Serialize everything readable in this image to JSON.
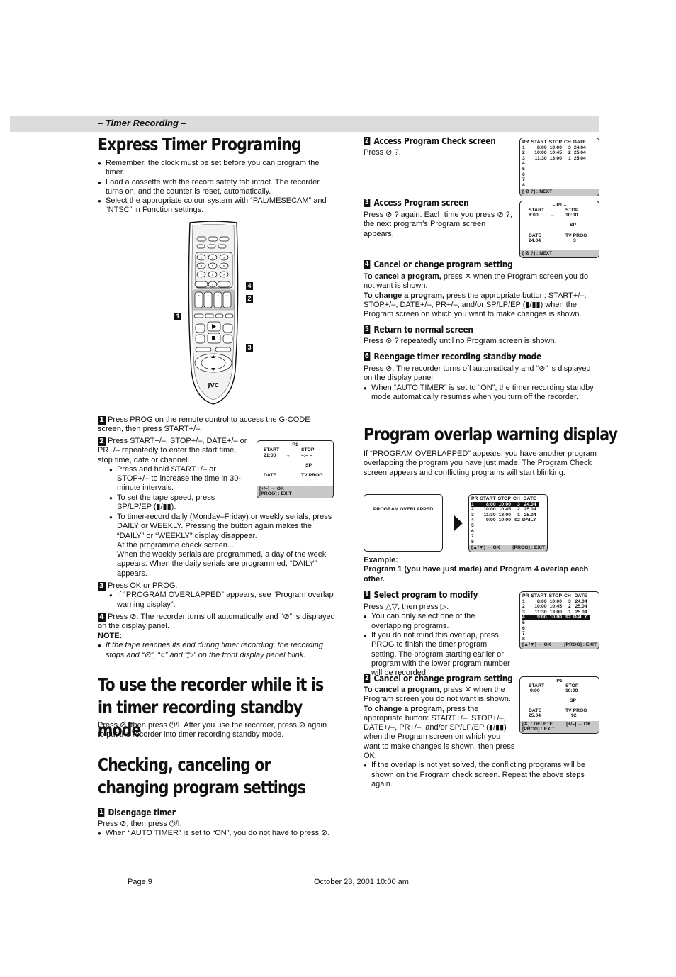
{
  "header": {
    "section": "– Timer Recording –"
  },
  "left": {
    "title": "Express Timer Programing",
    "intro_bullets": [
      "Remember, the clock must be set before you can program the timer.",
      "Load a cassette with the record safety tab intact. The recorder turns on, and the counter is reset, automatically.",
      "Select the appropriate colour system with “PAL/MESECAM” and “NTSC” in Function settings."
    ],
    "remote": {
      "brand": "JVC",
      "markers": [
        "1",
        "2",
        "3",
        "4"
      ],
      "numpad": [
        "1",
        "2",
        "3",
        "4",
        "5",
        "6",
        "7",
        "8",
        "9",
        "0"
      ]
    },
    "steps": [
      {
        "num": "1",
        "text": "Press PROG on the remote control to access the G-CODE screen, then press START+/–."
      },
      {
        "num": "2",
        "text": "Press START+/–, STOP+/–, DATE+/– or PR+/– repeatedly to enter the start time, stop time, date or channel.",
        "bullets": [
          "Press and hold START+/– or STOP+/– to increase the time in 30-minute intervals.",
          "To set the tape speed, press SP/LP/EP (▮/▮▮).",
          "To timer-record daily (Monday–Friday) or weekly serials, press DAILY or WEEKLY. Pressing the button again makes the “DAILY” or “WEEKLY” display disappear."
        ],
        "extra": [
          "At the programme check screen...",
          "When the weekly serials are programmed, a day of the week appears. When the daily serials are programmed, “DAILY” appears."
        ]
      },
      {
        "num": "3",
        "text": "Press OK or PROG.",
        "bullets": [
          "If “PROGRAM OVERLAPPED” appears, see “Program overlap warning display”."
        ]
      },
      {
        "num": "4",
        "text": "Press ⊘. The recorder turns off automatically and “⊘” is displayed on the display panel."
      }
    ],
    "note_label": "NOTE:",
    "note": "If the tape reaches its end during timer recording, the recording stops and “⊘”, “○” and “▷” on the front display panel blink.",
    "screen_p1_new": {
      "title": "– P1 –",
      "start_label": "START",
      "start": "21:00",
      "stop_label": "STOP",
      "stop": "–:– –",
      "speed": "SP",
      "date_label": "DATE",
      "date": "– –.– –",
      "tvprog_label": "TV PROG",
      "tvprog": "– –",
      "footer1": "[+/–] → OK",
      "footer2": "[PROG] : EXIT"
    },
    "standby_title": "To use the recorder while it is in timer recording standby mode",
    "standby_text": "Press ⊘, then press ⏻/I. After you use the recorder, press ⊘ again to put the recorder into timer recording standby mode.",
    "checking_title": "Checking, canceling or changing program settings",
    "disengage": {
      "num": "1",
      "title": "Disengage timer",
      "text": "Press ⊘, then press ⏻/I.",
      "bullet": "When “AUTO TIMER” is set to “ON”, you do not have to press ⊘."
    }
  },
  "right": {
    "steps": [
      {
        "num": "2",
        "title": "Access Program Check screen",
        "text": "Press ⊘ ?."
      },
      {
        "num": "3",
        "title": "Access Program screen",
        "text": "Press ⊘ ? again. Each time you press ⊘ ?, the next program’s Program screen appears."
      },
      {
        "num": "4",
        "title": "Cancel or change program setting",
        "cancel_label": "To cancel a program,",
        "cancel_text": " press ✕ when the Program screen you do not want is shown.",
        "change_label": "To change a program,",
        "change_text": " press the appropriate button: START+/–, STOP+/–, DATE+/–, PR+/–, and/or SP/LP/EP (▮/▮▮) when the Program screen on which you want to make changes is shown."
      },
      {
        "num": "5",
        "title": "Return to normal screen",
        "text": "Press ⊘ ? repeatedly until no Program screen is shown."
      },
      {
        "num": "6",
        "title": "Reengage timer recording standby mode",
        "text": "Press ⊘. The recorder turns off automatically and “⊘” is displayed on the display panel.",
        "bullet": "When “AUTO TIMER” is set to “ON”, the timer recording standby mode automatically resumes when you turn off the recorder."
      }
    ],
    "check_screen": {
      "headers": [
        "PR",
        "START",
        "STOP",
        "CH",
        "DATE"
      ],
      "rows": [
        [
          "1",
          "8:00",
          "10:00",
          "3",
          "24.04"
        ],
        [
          "2",
          "10:00",
          "10:45",
          "2",
          "25.04"
        ],
        [
          "3",
          "11:30",
          "13:00",
          "1",
          "25.04"
        ],
        [
          "4",
          "",
          "",
          "",
          ""
        ],
        [
          "5",
          "",
          "",
          "",
          ""
        ],
        [
          "6",
          "",
          "",
          "",
          ""
        ],
        [
          "7",
          "",
          "",
          "",
          ""
        ],
        [
          "8",
          "",
          "",
          "",
          ""
        ]
      ],
      "footer": "[ ⊘ ?] : NEXT"
    },
    "program_screen": {
      "title": "– P1 –",
      "start_label": "START",
      "start": "8:00",
      "stop_label": "STOP",
      "stop": "10:00",
      "speed": "SP",
      "date_label": "DATE",
      "date": "24.04",
      "tvprog_label": "TV PROG",
      "tvprog": "3",
      "footer": "[ ⊘ ?] : NEXT"
    },
    "overlap_title": "Program overlap warning display",
    "overlap_text": "If “PROGRAM OVERLAPPED” appears, you have another program overlapping the program you have just made. The Program Check screen appears and conflicting programs will start blinking.",
    "overlap_screen_text": "PROGRAM OVERLAPPED",
    "overlap_check": {
      "headers": [
        "PR",
        "START",
        "STOP",
        "CH",
        "DATE"
      ],
      "rows": [
        [
          "1",
          "8:00",
          "10:00",
          "3",
          "24.04"
        ],
        [
          "2",
          "10:00",
          "10:45",
          "2",
          "25.04"
        ],
        [
          "3",
          "11:30",
          "13:00",
          "1",
          "25.04"
        ],
        [
          "4",
          "9:00",
          "10:00",
          "92",
          "DAILY"
        ],
        [
          "5",
          "",
          "",
          "",
          ""
        ],
        [
          "6",
          "",
          "",
          "",
          ""
        ],
        [
          "7",
          "",
          "",
          "",
          ""
        ],
        [
          "8",
          "",
          "",
          "",
          ""
        ]
      ],
      "footer_left": "[▲/▼] → OK",
      "footer_right": "[PROG] : EXIT"
    },
    "example_label": "Example:",
    "example_text": "Program 1 (you have just made) and Program 4 overlap each other.",
    "modify": {
      "num": "1",
      "title": "Select program to modify",
      "text": "Press △▽, then press ▷.",
      "bullets": [
        "You can only select one of the overlapping programs.",
        "If you do not mind this overlap, press PROG to finish the timer program setting. The program starting earlier or program with the lower program number will be recorded."
      ]
    },
    "change2": {
      "num": "2",
      "title": "Cancel or change program setting",
      "cancel_label": "To cancel a program,",
      "cancel_text": " press ✕ when the Program screen you do not want is shown.",
      "change_label": "To change a program,",
      "change_text": " press the appropriate button: START+/–, STOP+/–, DATE+/–, PR+/–, and/or SP/LP/EP (▮/▮▮) when the Program screen on which you want to make changes is shown, then press OK.",
      "bullet": "If the overlap is not yet solved, the conflicting programs will be shown on the Program check screen. Repeat the above steps again."
    },
    "p1_edit_screen": {
      "title": "– P1 –",
      "start_label": "START",
      "start": "9:00",
      "stop_label": "STOP",
      "stop": "10:00",
      "speed": "SP",
      "date_label": "DATE",
      "date": "25.04",
      "tvprog_label": "TV PROG",
      "tvprog": "92",
      "footer1": "[✕] : DELETE",
      "footer1r": "[+/–] → OK",
      "footer2": "[PROG] : EXIT"
    }
  },
  "footer": {
    "page": "Page 9",
    "date": "October 23, 2001 10:00 am"
  }
}
